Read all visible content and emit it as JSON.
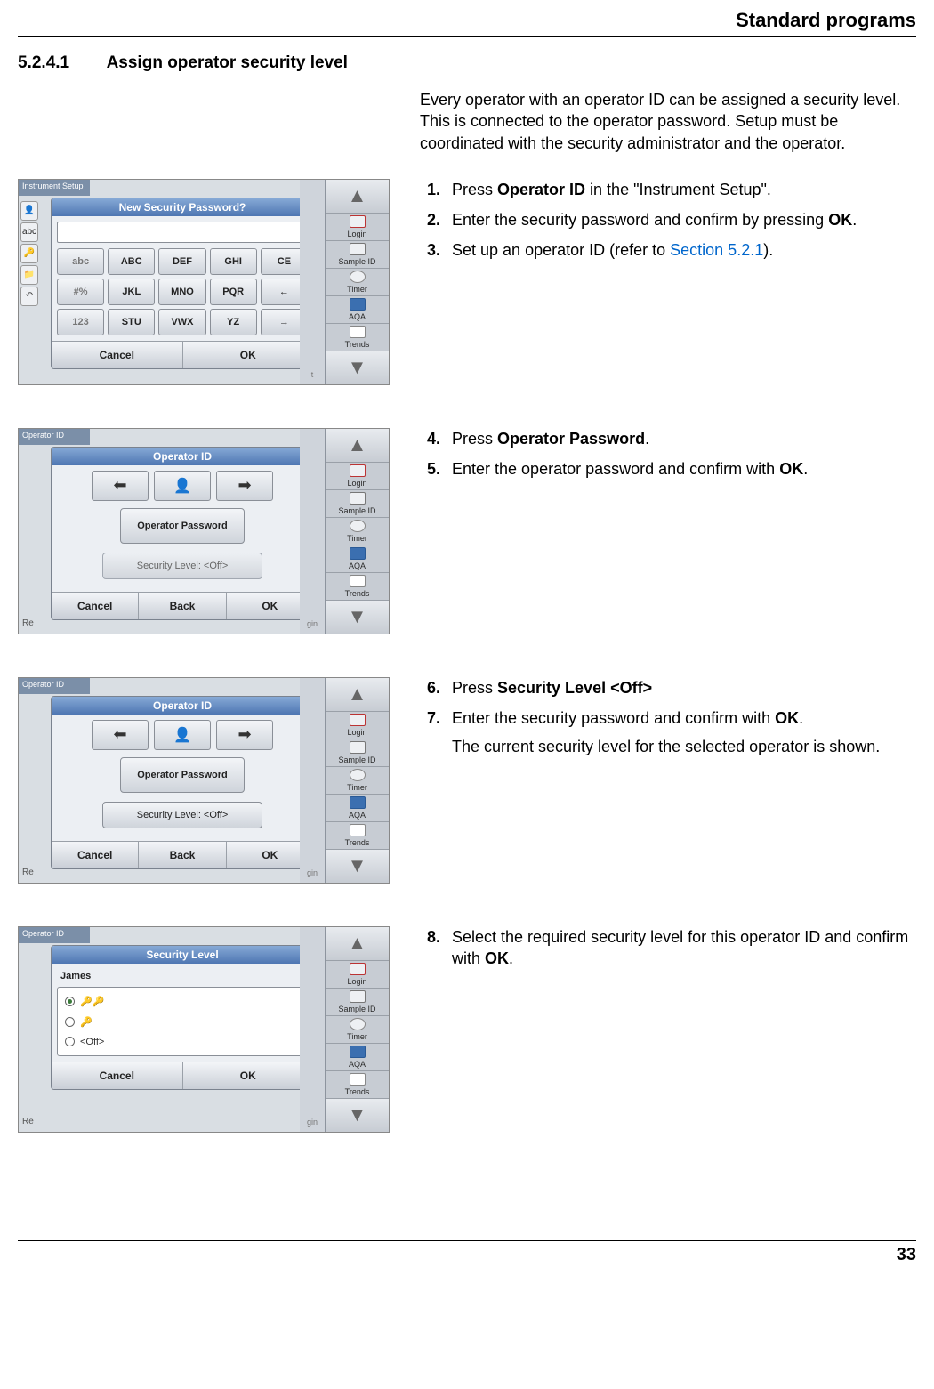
{
  "header": {
    "running_head": "Standard programs"
  },
  "section": {
    "number": "5.2.4.1",
    "title": "Assign operator security level",
    "intro": "Every operator with an operator ID can be assigned a security level. This is connected to the operator password. Setup must be coordinated with the security administrator and the operator."
  },
  "sidebar_items": [
    {
      "key": "login",
      "label": "Login"
    },
    {
      "key": "sample",
      "label": "Sample ID"
    },
    {
      "key": "timer",
      "label": "Timer"
    },
    {
      "key": "aqa",
      "label": "AQA"
    },
    {
      "key": "trends",
      "label": "Trends"
    }
  ],
  "block1": {
    "topbar": "Instrument Setup",
    "dialog_title": "New Security Password?",
    "keys": [
      [
        "abc",
        "ABC",
        "DEF",
        "GHI",
        "CE"
      ],
      [
        "#%",
        "JKL",
        "MNO",
        "PQR",
        "←"
      ],
      [
        "123",
        "STU",
        "VWX",
        "YZ",
        "→"
      ]
    ],
    "footer": [
      "Cancel",
      "OK"
    ],
    "overflow_label": "t",
    "steps": [
      {
        "pre": "Press ",
        "bold": "Operator ID",
        "post": " in the \"Instrument Setup\"."
      },
      {
        "pre": "Enter the security password and confirm by pressing ",
        "bold": "OK",
        "post": "."
      },
      {
        "pre": "Set up an operator ID (refer to ",
        "link": "Section 5.2.1",
        "post": ")."
      }
    ]
  },
  "block2": {
    "topbar": "Operator ID",
    "dialog_title": "Operator ID",
    "bigbtn": "Operator Password",
    "sec_level_btn": "Security Level:   <Off>",
    "footer": [
      "Cancel",
      "Back",
      "OK"
    ],
    "overflow_label": "gin",
    "left_label": "Re",
    "steps": [
      {
        "pre": "Press ",
        "bold": "Operator Password",
        "post": "."
      },
      {
        "pre": "Enter the operator password and confirm with ",
        "bold": "OK",
        "post": "."
      }
    ]
  },
  "block3": {
    "topbar": "Operator ID",
    "dialog_title": "Operator ID",
    "bigbtn": "Operator Password",
    "sec_level_btn": "Security Level:   <Off>",
    "footer": [
      "Cancel",
      "Back",
      "OK"
    ],
    "overflow_label": "gin",
    "left_label": "Re",
    "steps": [
      {
        "pre": "Press ",
        "bold": "Security Level <Off>",
        "post": ""
      },
      {
        "pre": "Enter the security password and confirm with ",
        "bold": "OK",
        "post": "."
      }
    ],
    "extra_line": "The current security level for the selected operator is shown."
  },
  "block4": {
    "topbar": "Operator ID",
    "dialog_title": "Security Level",
    "list_head": "James",
    "options": [
      {
        "label_icons": "🔑🔑",
        "label": "",
        "selected": true
      },
      {
        "label_icons": "🔑",
        "label": "",
        "selected": false
      },
      {
        "label_icons": "",
        "label": "<Off>",
        "selected": false
      }
    ],
    "footer": [
      "Cancel",
      "OK"
    ],
    "overflow_label": "gin",
    "left_label": "Re",
    "steps": [
      {
        "pre": "Select the required security level for this operator ID and confirm with ",
        "bold": "OK",
        "post": "."
      }
    ]
  },
  "page_number": "33"
}
